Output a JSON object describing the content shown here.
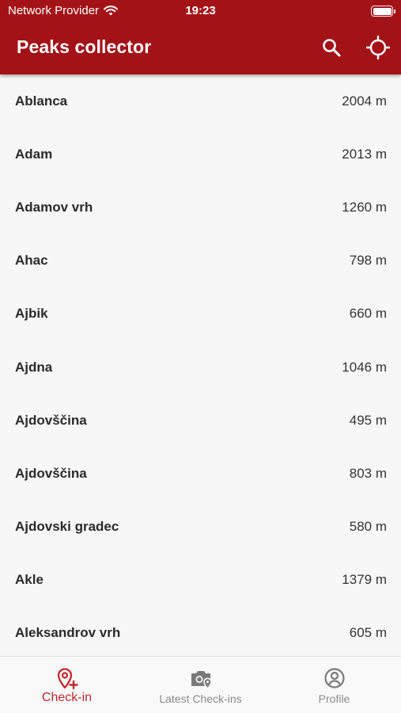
{
  "status_bar": {
    "carrier": "Network Provider",
    "time": "19:23"
  },
  "app_bar": {
    "title": "Peaks collector",
    "search_icon": "search-icon",
    "locate_icon": "crosshair-icon"
  },
  "colors": {
    "primary": "#a31217",
    "accent": "#c2272d",
    "inactive": "#8a8a8a"
  },
  "peaks": [
    {
      "name": "Ablanca",
      "elevation": "2004 m"
    },
    {
      "name": "Adam",
      "elevation": "2013 m"
    },
    {
      "name": "Adamov vrh",
      "elevation": "1260 m"
    },
    {
      "name": "Ahac",
      "elevation": "798 m"
    },
    {
      "name": "Ajbik",
      "elevation": "660 m"
    },
    {
      "name": "Ajdna",
      "elevation": "1046 m"
    },
    {
      "name": "Ajdovščina",
      "elevation": "495 m"
    },
    {
      "name": "Ajdovščina",
      "elevation": "803 m"
    },
    {
      "name": "Ajdovski gradec",
      "elevation": "580 m"
    },
    {
      "name": "Akle",
      "elevation": "1379 m"
    },
    {
      "name": "Aleksandrov vrh",
      "elevation": "605 m"
    }
  ],
  "tabs": [
    {
      "label": "Check-in",
      "icon": "pin-plus-icon",
      "active": true
    },
    {
      "label": "Latest Check-ins",
      "icon": "camera-pin-icon",
      "active": false
    },
    {
      "label": "Profile",
      "icon": "user-circle-icon",
      "active": false
    }
  ]
}
